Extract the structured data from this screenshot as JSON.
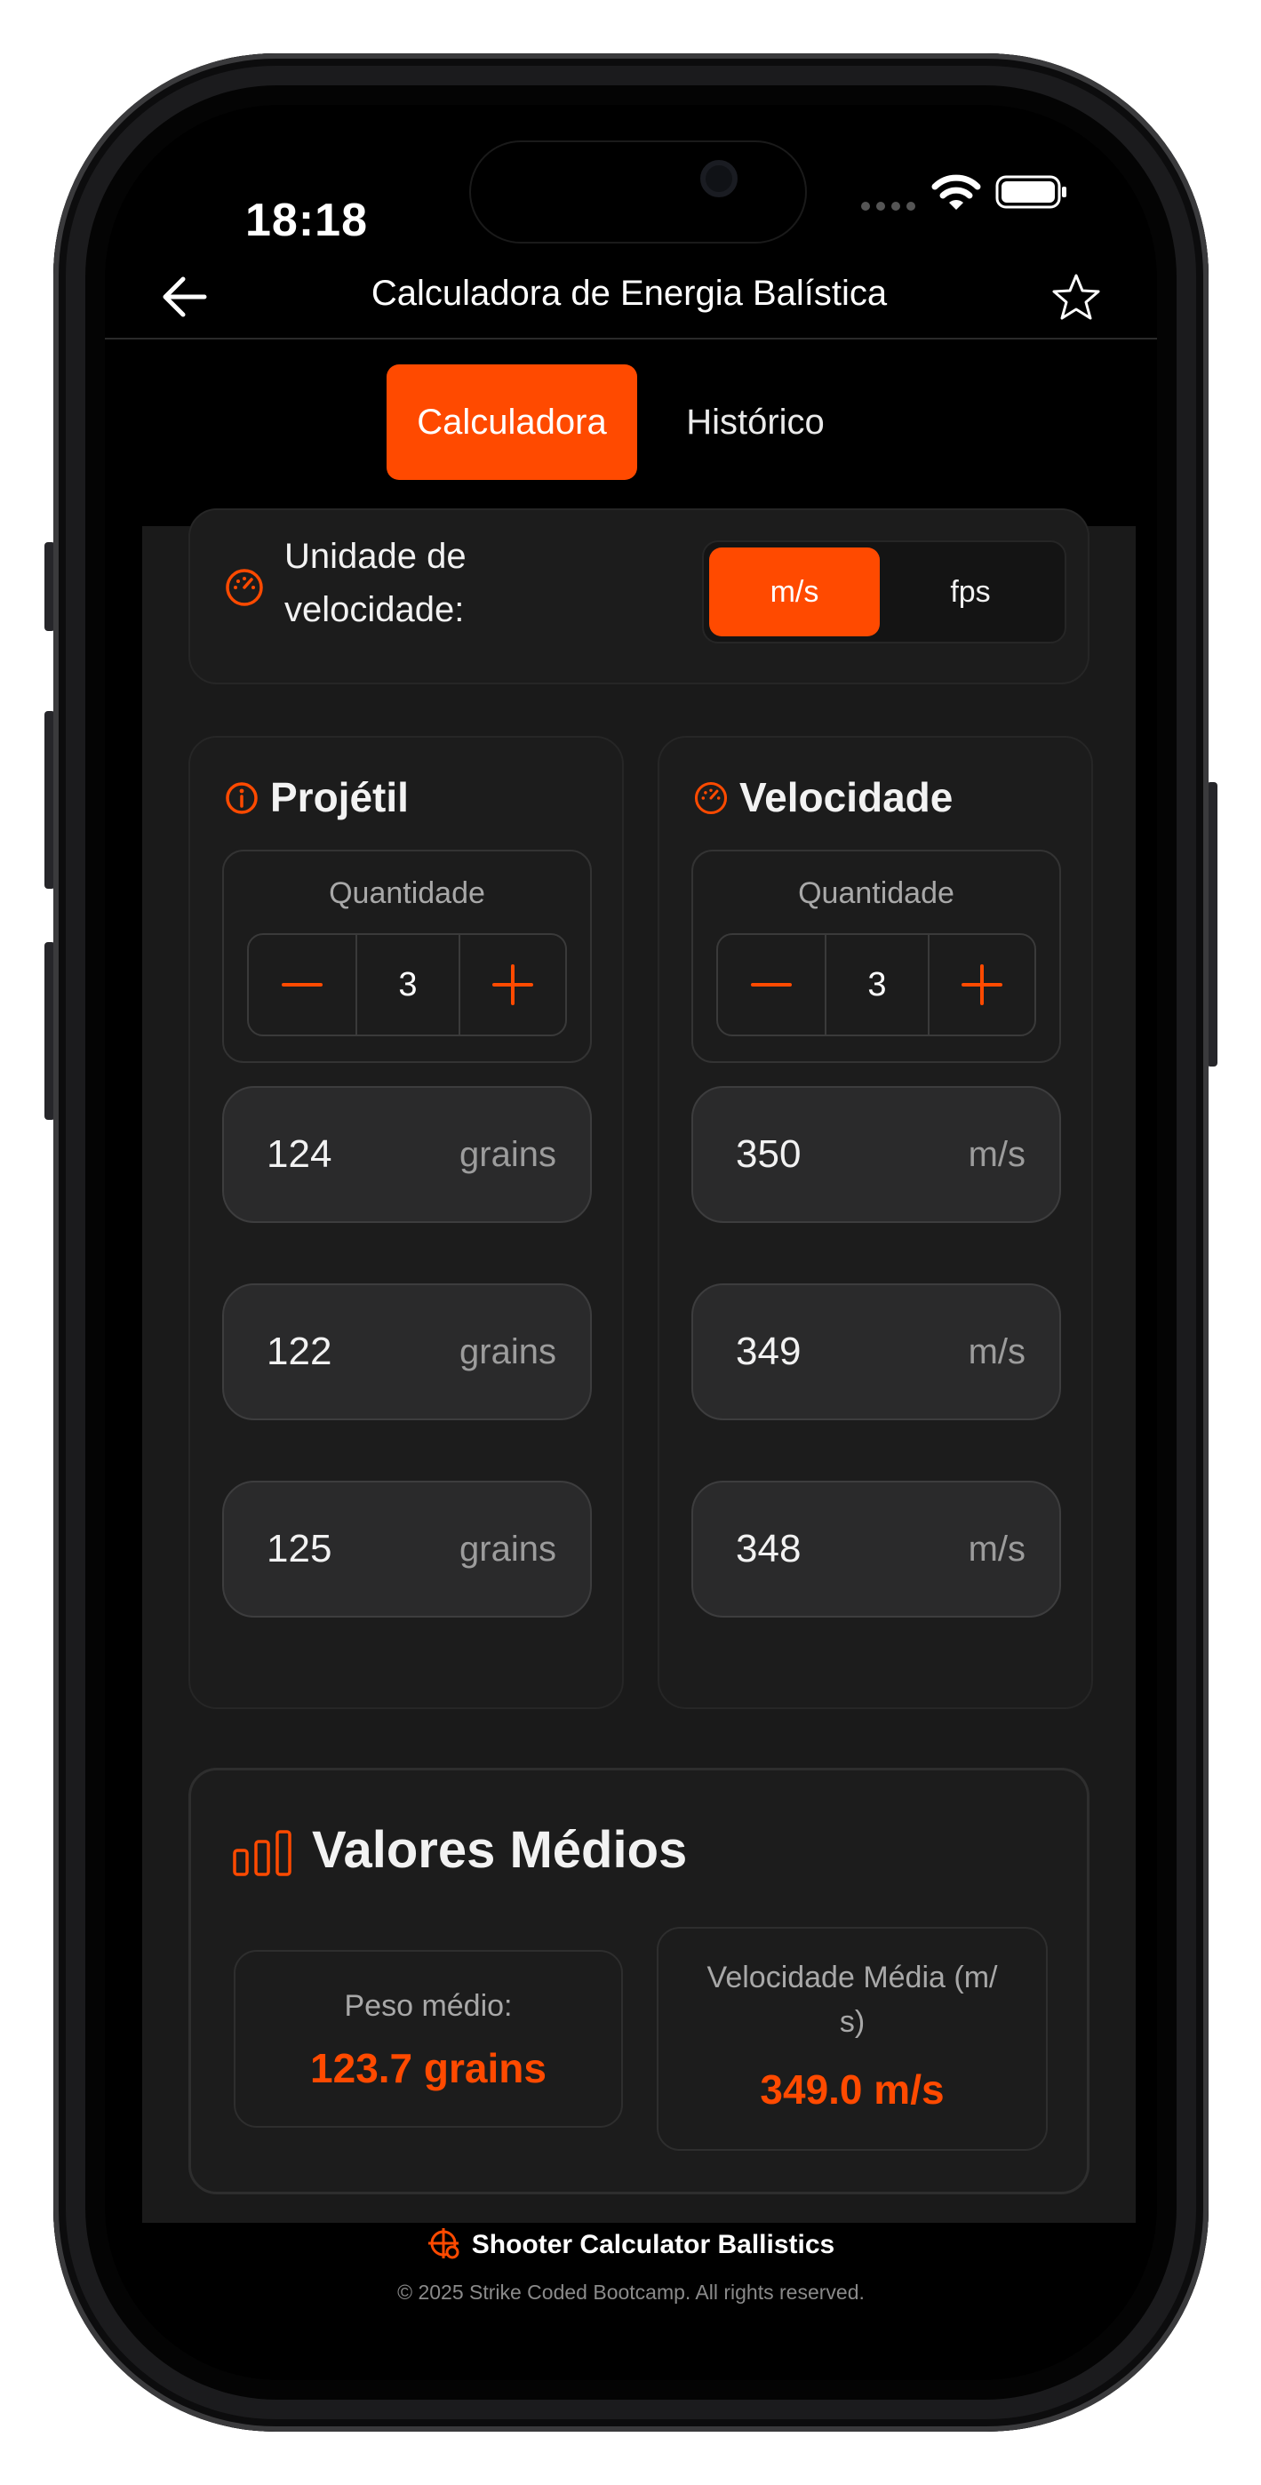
{
  "status_bar": {
    "time": "18:18"
  },
  "header": {
    "title": "Calculadora de Energia Balística"
  },
  "tabs": [
    {
      "label": "Calculadora",
      "active": true
    },
    {
      "label": "Histórico",
      "active": false
    }
  ],
  "velocity_unit": {
    "label_line1": "Unidade de",
    "label_line2": "velocidade:",
    "options": [
      "m/s",
      "fps"
    ],
    "selected": "m/s"
  },
  "projectile": {
    "title": "Projétil",
    "quantity_label": "Quantidade",
    "quantity": "3",
    "unit": "grains",
    "values": [
      "124",
      "122",
      "125"
    ]
  },
  "velocity": {
    "title": "Velocidade",
    "quantity_label": "Quantidade",
    "quantity": "3",
    "unit": "m/s",
    "values": [
      "350",
      "349",
      "348"
    ]
  },
  "averages": {
    "title": "Valores Médios",
    "weight_label": "Peso médio:",
    "weight_value": "123.7 grains",
    "speed_label_line1": "Velocidade Média (m/",
    "speed_label_line2": "s)",
    "speed_value": "349.0 m/s"
  },
  "footer": {
    "brand": "Shooter Calculator Ballistics",
    "copyright": "© 2025 Strike Coded Bootcamp. All rights reserved."
  },
  "colors": {
    "accent": "#ff4a00",
    "background": "#000000",
    "panel": "#1a1a1a",
    "card": "#1c1c1c",
    "field": "#2a2a2b"
  },
  "icons": [
    "back-arrow-icon",
    "star-icon",
    "speedometer-icon",
    "info-icon",
    "bar-chart-icon",
    "crosshair-icon",
    "wifi-icon",
    "battery-icon",
    "signal-dots-icon",
    "minus-icon",
    "plus-icon"
  ]
}
